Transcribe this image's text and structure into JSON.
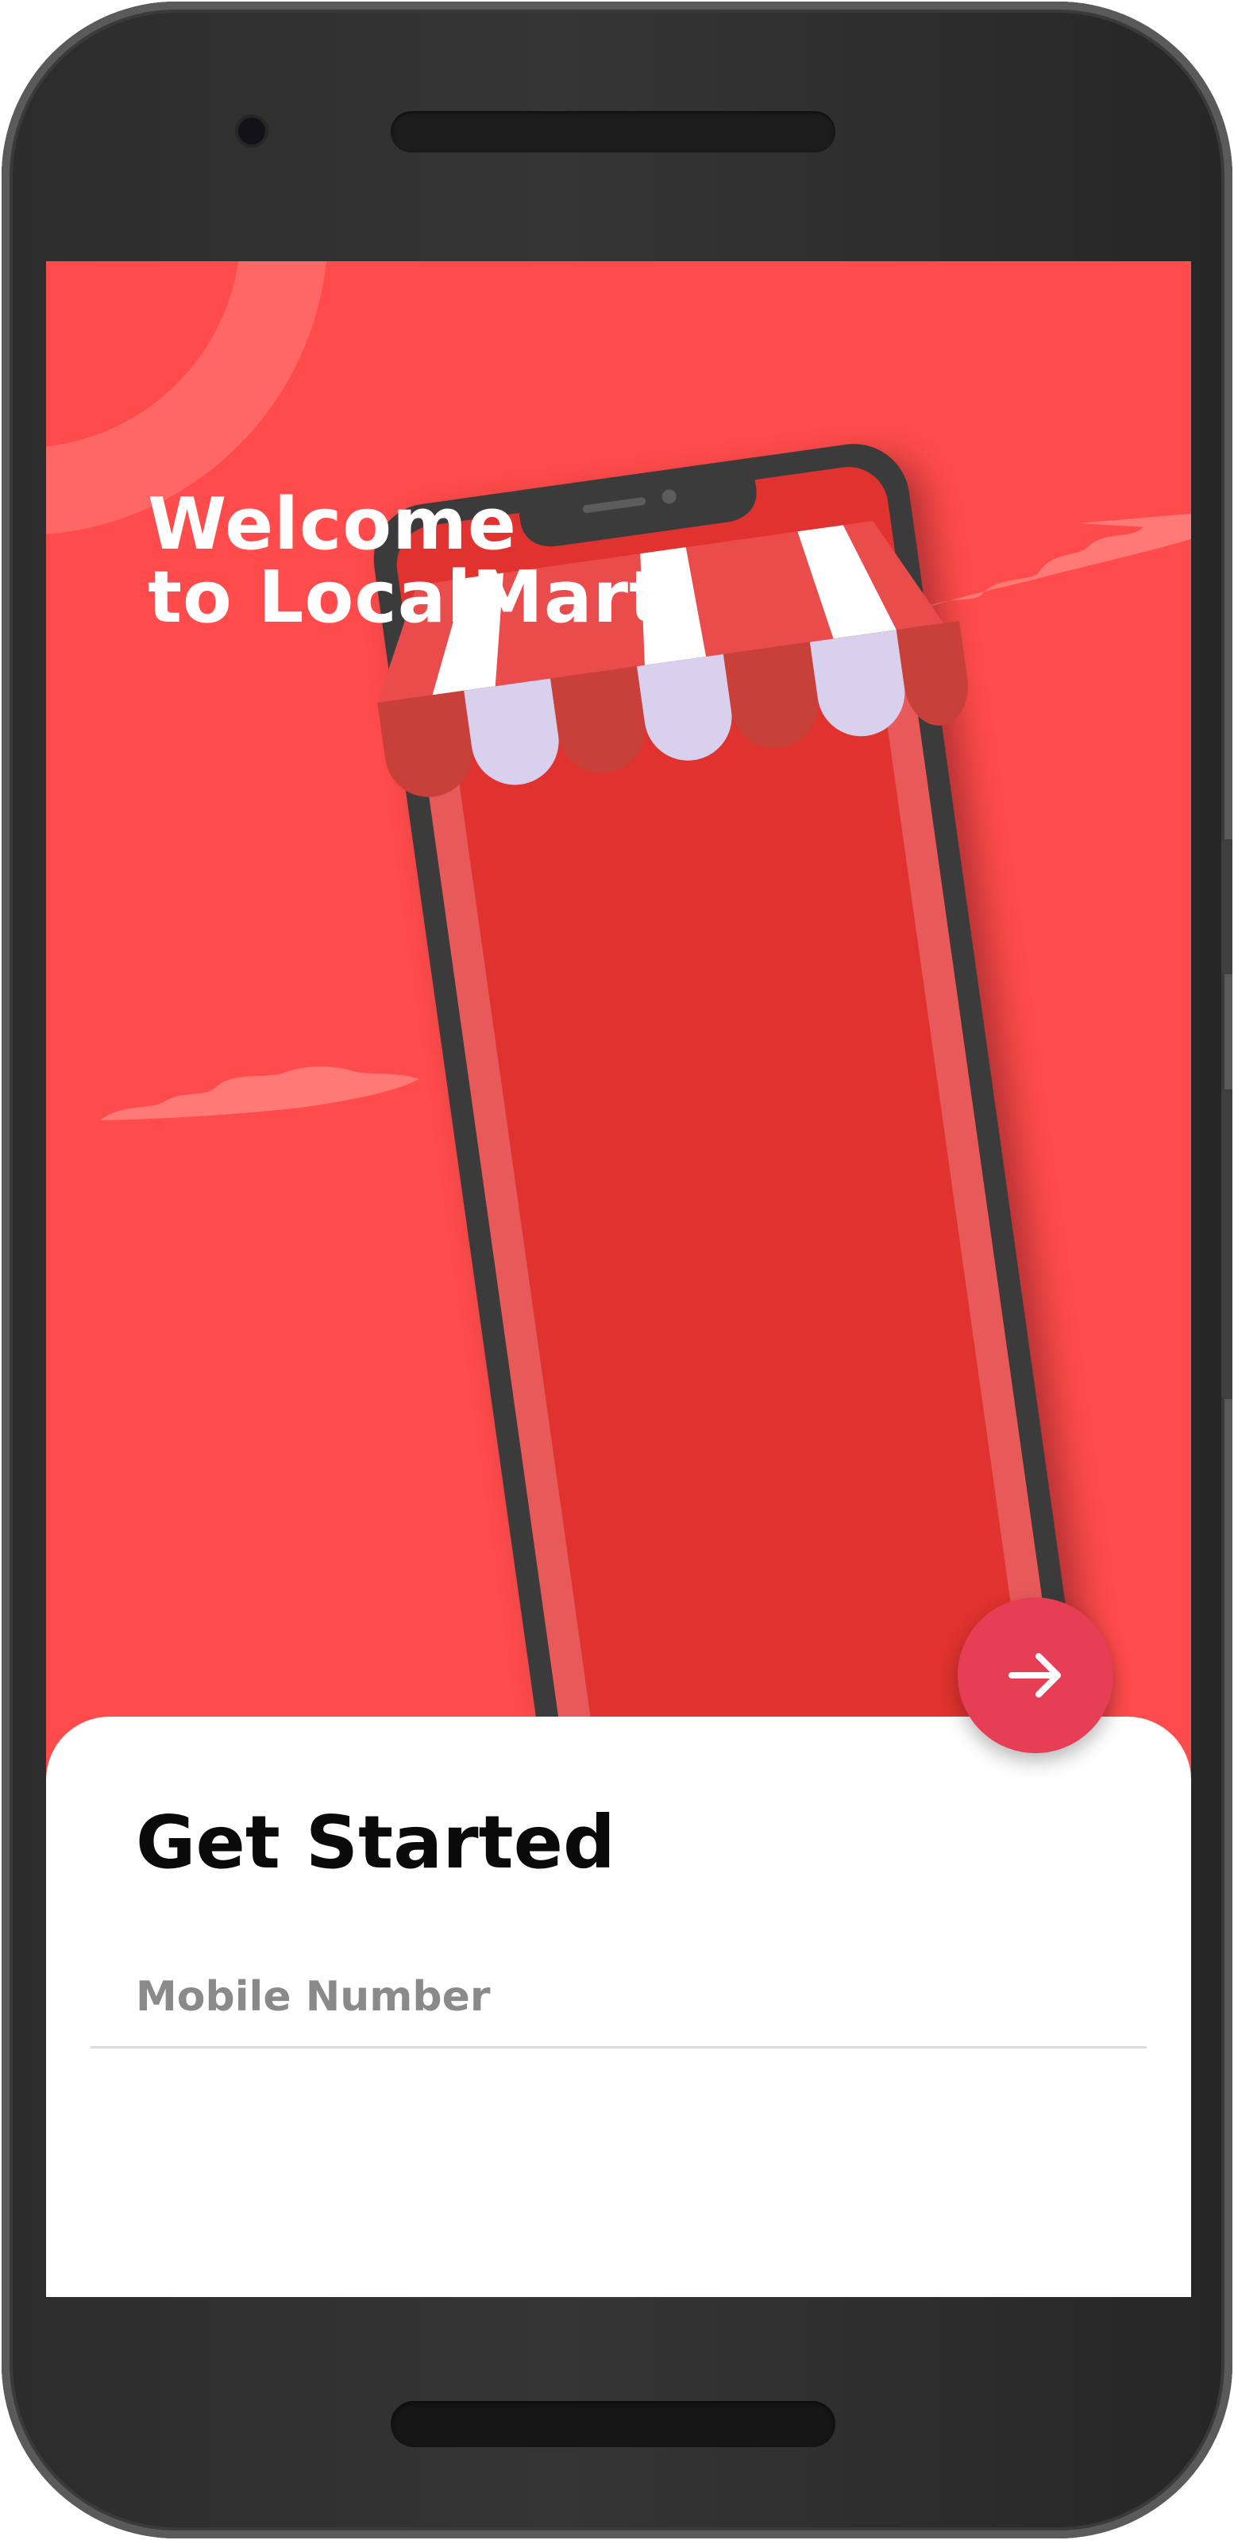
{
  "welcome": {
    "line1": "Welcome",
    "line2": "to LocalMart"
  },
  "get_started": {
    "title": "Get Started",
    "mobile_placeholder": "Mobile Number",
    "mobile_value": "",
    "next_icon": "arrow-right-icon"
  },
  "colors": {
    "background": "#ff4b4b",
    "accent": "#e63e55",
    "phone_screen": "#e0322e",
    "awning_stripe": "#d8d0ec"
  }
}
